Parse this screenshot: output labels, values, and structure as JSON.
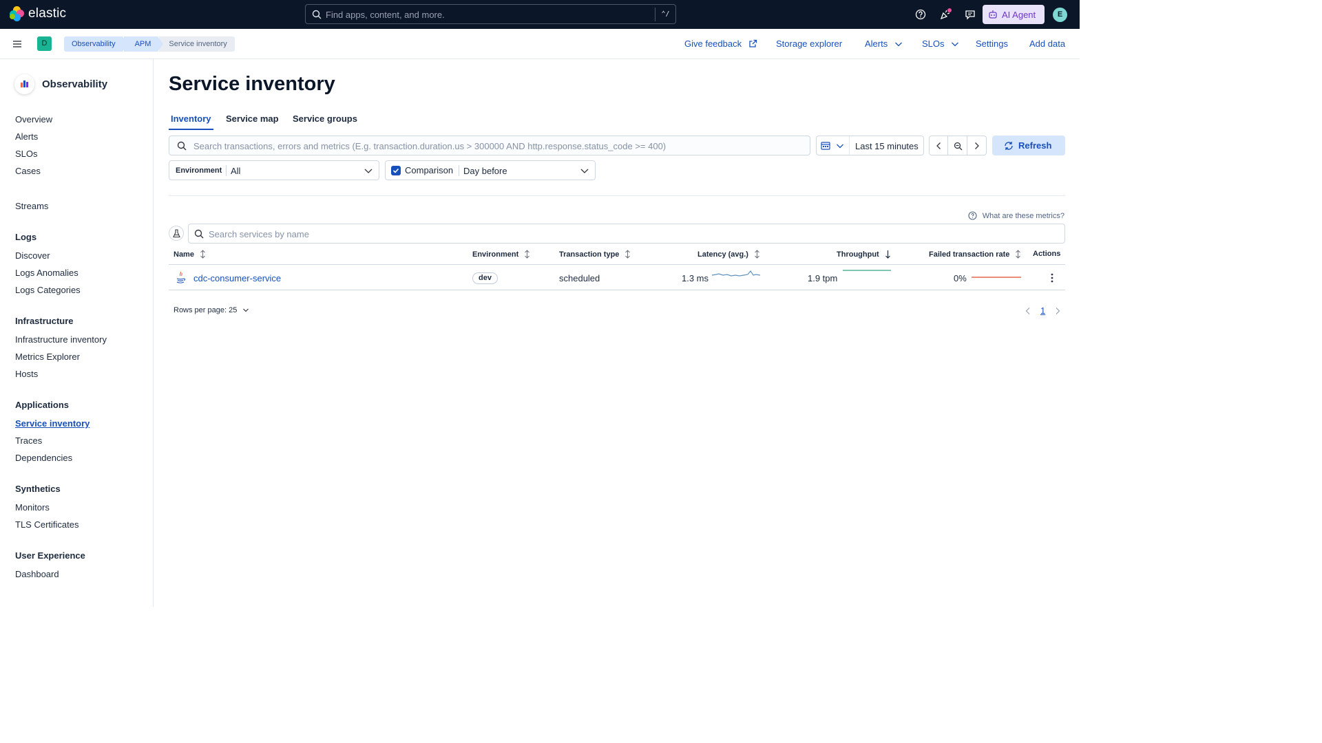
{
  "header": {
    "brand": "elastic",
    "search_placeholder": "Find apps, content, and more.",
    "search_shortcut": "⌃/",
    "ai_agent_label": "AI Agent",
    "avatar_initial": "E"
  },
  "subheader": {
    "space_initial": "D",
    "breadcrumbs": [
      "Observability",
      "APM",
      "Service inventory"
    ],
    "nav": {
      "give_feedback": "Give feedback",
      "storage_explorer": "Storage explorer",
      "alerts": "Alerts",
      "slos": "SLOs",
      "settings": "Settings",
      "add_data": "Add data"
    }
  },
  "sidebar": {
    "title": "Observability",
    "items": {
      "overview": "Overview",
      "alerts": "Alerts",
      "slos": "SLOs",
      "cases": "Cases",
      "streams": "Streams",
      "logs": "Logs",
      "discover": "Discover",
      "logs_anomalies": "Logs Anomalies",
      "logs_categories": "Logs Categories",
      "infrastructure": "Infrastructure",
      "infrastructure_inventory": "Infrastructure inventory",
      "metrics_explorer": "Metrics Explorer",
      "hosts": "Hosts",
      "applications": "Applications",
      "service_inventory": "Service inventory",
      "traces": "Traces",
      "dependencies": "Dependencies",
      "synthetics": "Synthetics",
      "monitors": "Monitors",
      "tls_certificates": "TLS Certificates",
      "user_experience": "User Experience",
      "dashboard": "Dashboard"
    }
  },
  "main": {
    "title": "Service inventory",
    "tabs": [
      "Inventory",
      "Service map",
      "Service groups"
    ],
    "query_placeholder": "Search transactions, errors and metrics (E.g. transaction.duration.us > 300000 AND http.response.status_code >= 400)",
    "time_range": "Last 15 minutes",
    "refresh_label": "Refresh",
    "environment_label": "Environment",
    "environment_value": "All",
    "comparison_label": "Comparison",
    "comparison_value": "Day before",
    "metrics_help": "What are these metrics?",
    "service_search_placeholder": "Search services by name",
    "table": {
      "columns": [
        "Name",
        "Environment",
        "Transaction type",
        "Latency (avg.)",
        "Throughput",
        "Failed transaction rate",
        "Actions"
      ],
      "rows": [
        {
          "name": "cdc-consumer-service",
          "environment": "dev",
          "transaction_type": "scheduled",
          "latency": "1.3 ms",
          "throughput": "1.9 tpm",
          "failed_rate": "0%"
        }
      ]
    },
    "rows_per_page": "Rows per page: 25",
    "current_page": "1"
  },
  "colors": {
    "header_bg": "#0b1628",
    "link": "#1750ba",
    "latency_spark": "#6092c0",
    "throughput_spark": "#54b399",
    "failed_spark": "#e7664c"
  }
}
